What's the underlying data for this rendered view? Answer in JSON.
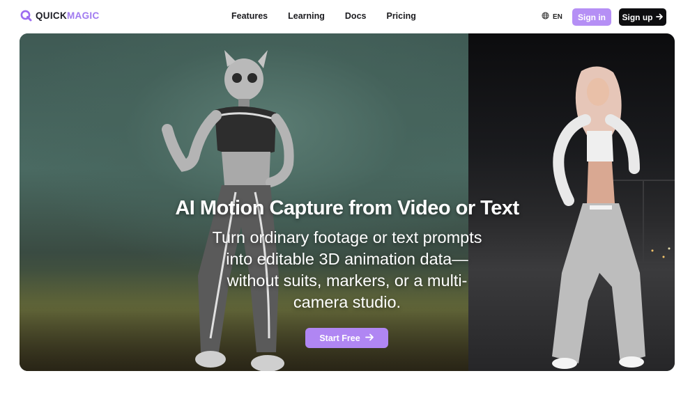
{
  "brand": {
    "name_part1": "QUICK",
    "name_part2": "MAGIC",
    "accent": "#a07af0"
  },
  "nav": {
    "links": [
      "Features",
      "Learning",
      "Docs",
      "Pricing"
    ],
    "language": "EN",
    "signin_label": "Sign in",
    "signup_label": "Sign up"
  },
  "hero": {
    "title": "AI Motion Capture from Video or Text",
    "subtitle": "Turn ordinary footage or text prompts into editable 3D animation data—without suits, markers, or a multi-camera studio.",
    "cta_label": "Start Free",
    "cta_color": "#b086f3"
  },
  "icons": [
    "logo-q-icon",
    "globe-icon",
    "arrow-right-icon"
  ]
}
